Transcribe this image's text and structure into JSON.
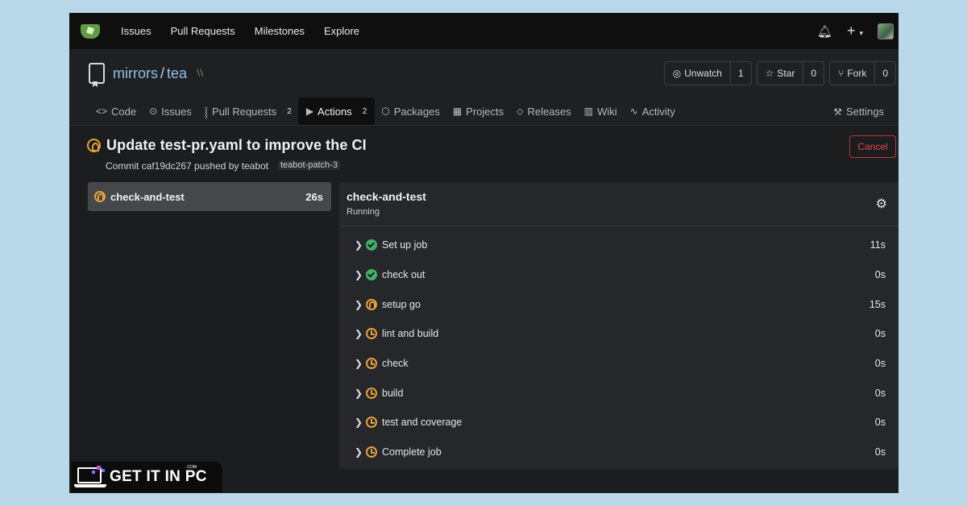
{
  "topnav": {
    "items": [
      "Issues",
      "Pull Requests",
      "Milestones",
      "Explore"
    ],
    "bell_icon": "bell-icon",
    "plus_icon": "plus-icon"
  },
  "repo": {
    "owner": "mirrors",
    "separator": "/",
    "name": "tea",
    "unwatch_label": "Unwatch",
    "unwatch_count": "1",
    "star_label": "Star",
    "star_count": "0",
    "fork_label": "Fork",
    "fork_count": "0"
  },
  "tabs": {
    "code": "Code",
    "issues": "Issues",
    "pulls": "Pull Requests",
    "pulls_count": "2",
    "actions": "Actions",
    "actions_count": "2",
    "packages": "Packages",
    "projects": "Projects",
    "releases": "Releases",
    "wiki": "Wiki",
    "activity": "Activity",
    "settings": "Settings"
  },
  "run": {
    "title": "Update test-pr.yaml to improve the CI",
    "subtitle": "Commit caf19dc267 pushed by teabot",
    "branch": "teabot-patch-3",
    "cancel_label": "Cancel"
  },
  "jobs": [
    {
      "name": "check-and-test",
      "time": "26s",
      "status": "running"
    }
  ],
  "panel": {
    "title": "check-and-test",
    "status": "Running"
  },
  "steps": [
    {
      "name": "Set up job",
      "time": "11s",
      "status": "success"
    },
    {
      "name": "check out",
      "time": "0s",
      "status": "success"
    },
    {
      "name": "setup go",
      "time": "15s",
      "status": "running"
    },
    {
      "name": "lint and build",
      "time": "0s",
      "status": "waiting"
    },
    {
      "name": "check",
      "time": "0s",
      "status": "waiting"
    },
    {
      "name": "build",
      "time": "0s",
      "status": "waiting"
    },
    {
      "name": "test and coverage",
      "time": "0s",
      "status": "waiting"
    },
    {
      "name": "Complete job",
      "time": "0s",
      "status": "waiting"
    }
  ],
  "watermark": {
    "text": "GET IT IN PC",
    "suffix": ".COM"
  },
  "colors": {
    "accent_link": "#8fc0e6",
    "running": "#e8a13a",
    "success": "#3fb46a",
    "danger": "#c5343b"
  }
}
